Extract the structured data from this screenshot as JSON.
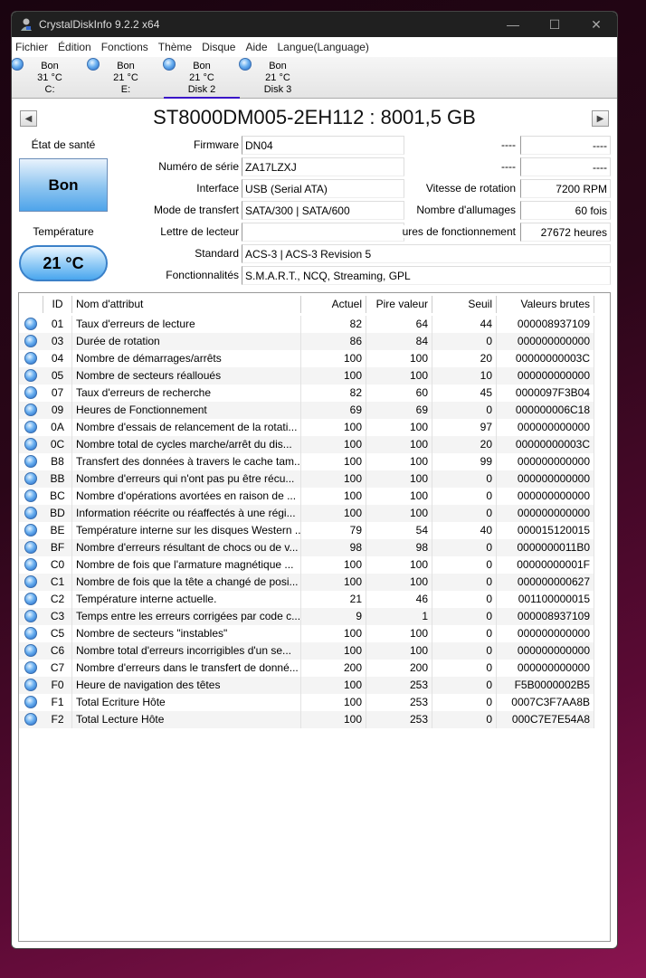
{
  "window": {
    "title": "CrystalDiskInfo 9.2.2 x64"
  },
  "menu": [
    "Fichier",
    "Édition",
    "Fonctions",
    "Thème",
    "Disque",
    "Aide",
    "Langue(Language)"
  ],
  "disks": [
    {
      "status": "Bon",
      "temp": "31 °C",
      "name": "C:"
    },
    {
      "status": "Bon",
      "temp": "21 °C",
      "name": "E:"
    },
    {
      "status": "Bon",
      "temp": "21 °C",
      "name": "Disk 2"
    },
    {
      "status": "Bon",
      "temp": "21 °C",
      "name": "Disk 3"
    }
  ],
  "model": "ST8000DM005-2EH112 : 8001,5 GB",
  "health": {
    "label": "État de santé",
    "value": "Bon"
  },
  "temperature": {
    "label": "Température",
    "value": "21 °C"
  },
  "info": {
    "firmware_label": "Firmware",
    "firmware": "DN04",
    "serial_label": "Numéro de série",
    "serial": "ZA17LZXJ",
    "interface_label": "Interface",
    "interface": "USB (Serial ATA)",
    "transfer_label": "Mode de transfert",
    "transfer": "SATA/300 | SATA/600",
    "letter_label": "Lettre de lecteur",
    "letter": "",
    "standard_label": "Standard",
    "standard": "ACS-3 | ACS-3 Revision 5",
    "features_label": "Fonctionnalités",
    "features": "S.M.A.R.T., NCQ, Streaming, GPL",
    "r1_label": "----",
    "r1": "----",
    "r2_label": "----",
    "r2": "----",
    "rotation_label": "Vitesse de rotation",
    "rotation": "7200 RPM",
    "power_count_label": "Nombre d'allumages",
    "power_count": "60 fois",
    "hours_label": "ures de fonctionnement",
    "hours": "27672 heures"
  },
  "table": {
    "headers": [
      "ID",
      "Nom d'attribut",
      "Actuel",
      "Pire valeur",
      "Seuil",
      "Valeurs brutes"
    ],
    "rows": [
      [
        "01",
        "Taux d'erreurs de lecture",
        "82",
        "64",
        "44",
        "000008937109"
      ],
      [
        "03",
        "Durée de rotation",
        "86",
        "84",
        "0",
        "000000000000"
      ],
      [
        "04",
        "Nombre de démarrages/arrêts",
        "100",
        "100",
        "20",
        "00000000003C"
      ],
      [
        "05",
        "Nombre de secteurs réalloués",
        "100",
        "100",
        "10",
        "000000000000"
      ],
      [
        "07",
        "Taux d'erreurs de recherche",
        "82",
        "60",
        "45",
        "0000097F3B04"
      ],
      [
        "09",
        "Heures de Fonctionnement",
        "69",
        "69",
        "0",
        "000000006C18"
      ],
      [
        "0A",
        "Nombre d'essais de relancement de la rotati...",
        "100",
        "100",
        "97",
        "000000000000"
      ],
      [
        "0C",
        "Nombre total de cycles marche/arrêt du dis...",
        "100",
        "100",
        "20",
        "00000000003C"
      ],
      [
        "B8",
        "Transfert des données à travers le cache tam...",
        "100",
        "100",
        "99",
        "000000000000"
      ],
      [
        "BB",
        "Nombre d'erreurs qui n'ont pas pu être récu...",
        "100",
        "100",
        "0",
        "000000000000"
      ],
      [
        "BC",
        "Nombre d'opérations avortées en raison de ...",
        "100",
        "100",
        "0",
        "000000000000"
      ],
      [
        "BD",
        "Information réécrite ou réaffectés à une régi...",
        "100",
        "100",
        "0",
        "000000000000"
      ],
      [
        "BE",
        "Température interne sur les disques Western ...",
        "79",
        "54",
        "40",
        "000015120015"
      ],
      [
        "BF",
        "Nombre d'erreurs résultant de chocs ou de v...",
        "98",
        "98",
        "0",
        "0000000011B0"
      ],
      [
        "C0",
        "Nombre de fois que l'armature magnétique ...",
        "100",
        "100",
        "0",
        "00000000001F"
      ],
      [
        "C1",
        "Nombre de fois que la tête a changé de posi...",
        "100",
        "100",
        "0",
        "000000000627"
      ],
      [
        "C2",
        "Température interne actuelle.",
        "21",
        "46",
        "0",
        "001100000015"
      ],
      [
        "C3",
        "Temps entre les erreurs corrigées par code c...",
        "9",
        "1",
        "0",
        "000008937109"
      ],
      [
        "C5",
        "Nombre de secteurs \"instables\"",
        "100",
        "100",
        "0",
        "000000000000"
      ],
      [
        "C6",
        "Nombre total d'erreurs incorrigibles d'un se...",
        "100",
        "100",
        "0",
        "000000000000"
      ],
      [
        "C7",
        "Nombre d'erreurs dans le transfert de donné...",
        "200",
        "200",
        "0",
        "000000000000"
      ],
      [
        "F0",
        "Heure de navigation des têtes",
        "100",
        "253",
        "0",
        "F5B0000002B5"
      ],
      [
        "F1",
        "Total Ecriture Hôte",
        "100",
        "253",
        "0",
        "0007C3F7AA8B"
      ],
      [
        "F2",
        "Total Lecture Hôte",
        "100",
        "253",
        "0",
        "000C7E7E54A8"
      ]
    ]
  }
}
